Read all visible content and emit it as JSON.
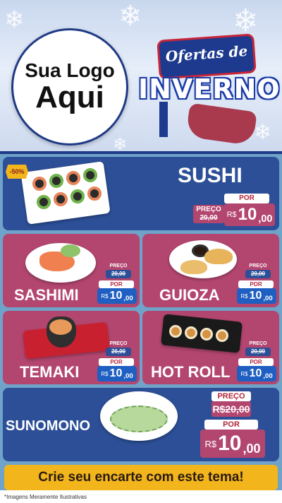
{
  "header": {
    "logo_line1": "Sua Logo",
    "logo_line2": "Aqui",
    "campaign_line1": "Ofertas de",
    "campaign_line2": "INVERNO"
  },
  "badge": {
    "discount": "-50%"
  },
  "products": [
    {
      "name": "SUSHI",
      "label_old": "PREÇO",
      "old": "20,00",
      "label_new": "POR",
      "currency": "R$",
      "new_int": "10",
      "new_cents": ",00"
    },
    {
      "name": "SASHIMI",
      "label_old": "PREÇO",
      "old": "20,00",
      "label_new": "POR",
      "currency": "R$",
      "new_int": "10",
      "new_cents": ",00"
    },
    {
      "name": "GUIOZA",
      "label_old": "PREÇO",
      "old": "20,00",
      "label_new": "POR",
      "currency": "R$",
      "new_int": "10",
      "new_cents": ",00"
    },
    {
      "name": "TEMAKI",
      "label_old": "PREÇO",
      "old": "20,00",
      "label_new": "POR",
      "currency": "R$",
      "new_int": "10",
      "new_cents": ",00"
    },
    {
      "name": "HOT ROLL",
      "label_old": "PREÇO",
      "old": "20,00",
      "label_new": "POR",
      "currency": "R$",
      "new_int": "10",
      "new_cents": ",00"
    },
    {
      "name": "SUNOMONO",
      "label_old": "PREÇO",
      "old": "R$20,00",
      "label_new": "POR",
      "currency": "R$",
      "new_int": "10",
      "new_cents": ",00"
    }
  ],
  "cta": "Crie seu encarte com este tema!",
  "disclaimer": "*Imagens Meramente Ilustrativas",
  "colors": {
    "blue_card": "#2c4f97",
    "pink_card": "#b3466f",
    "accent_yellow": "#f2b51c",
    "header_blue": "#1f3a86"
  }
}
